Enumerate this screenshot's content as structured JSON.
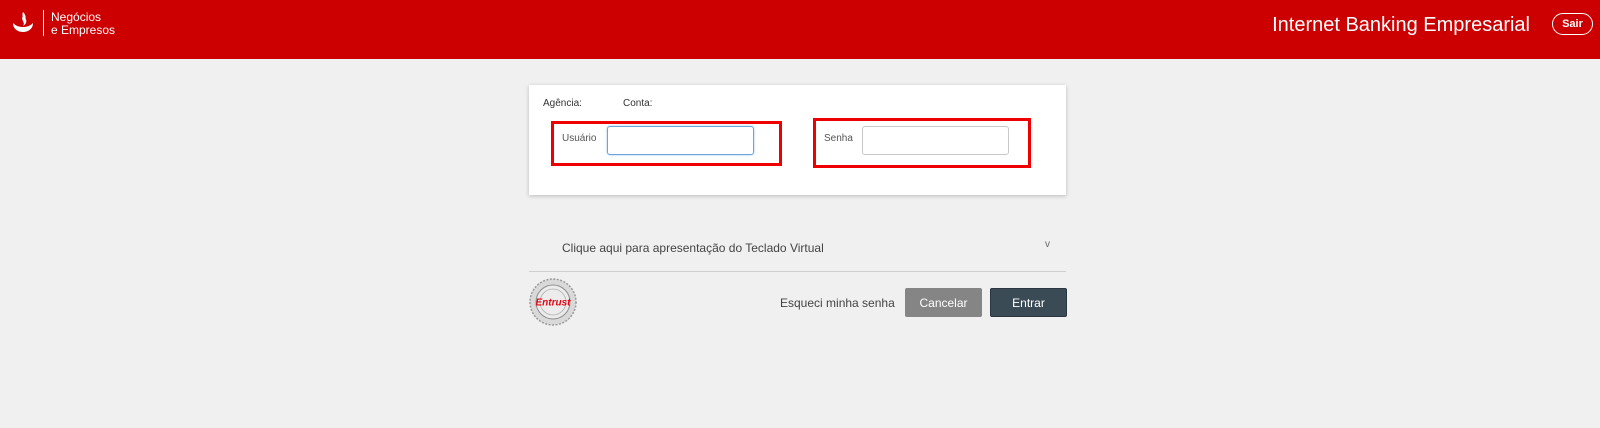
{
  "header": {
    "brand_line1": "Negócios",
    "brand_line2": "e Empresos",
    "app_title": "Internet Banking Empresarial",
    "logout_label": "Sair",
    "color": "#cc0000"
  },
  "login": {
    "agencia_label": "Agência:",
    "conta_label": "Conta:",
    "usuario_label": "Usuário",
    "usuario_value": "",
    "senha_label": "Senha",
    "senha_value": "",
    "highlight_color": "#ee0000"
  },
  "virtual_keyboard": {
    "label": "Clique aqui para apresentação do Teclado Virtual",
    "chevron": "v"
  },
  "actions": {
    "forgot_password": "Esqueci minha senha",
    "cancel_label": "Cancelar",
    "enter_label": "Entrar"
  },
  "seal": {
    "brand": "Entrust",
    "icon": "entrust-secured-seal-icon"
  }
}
